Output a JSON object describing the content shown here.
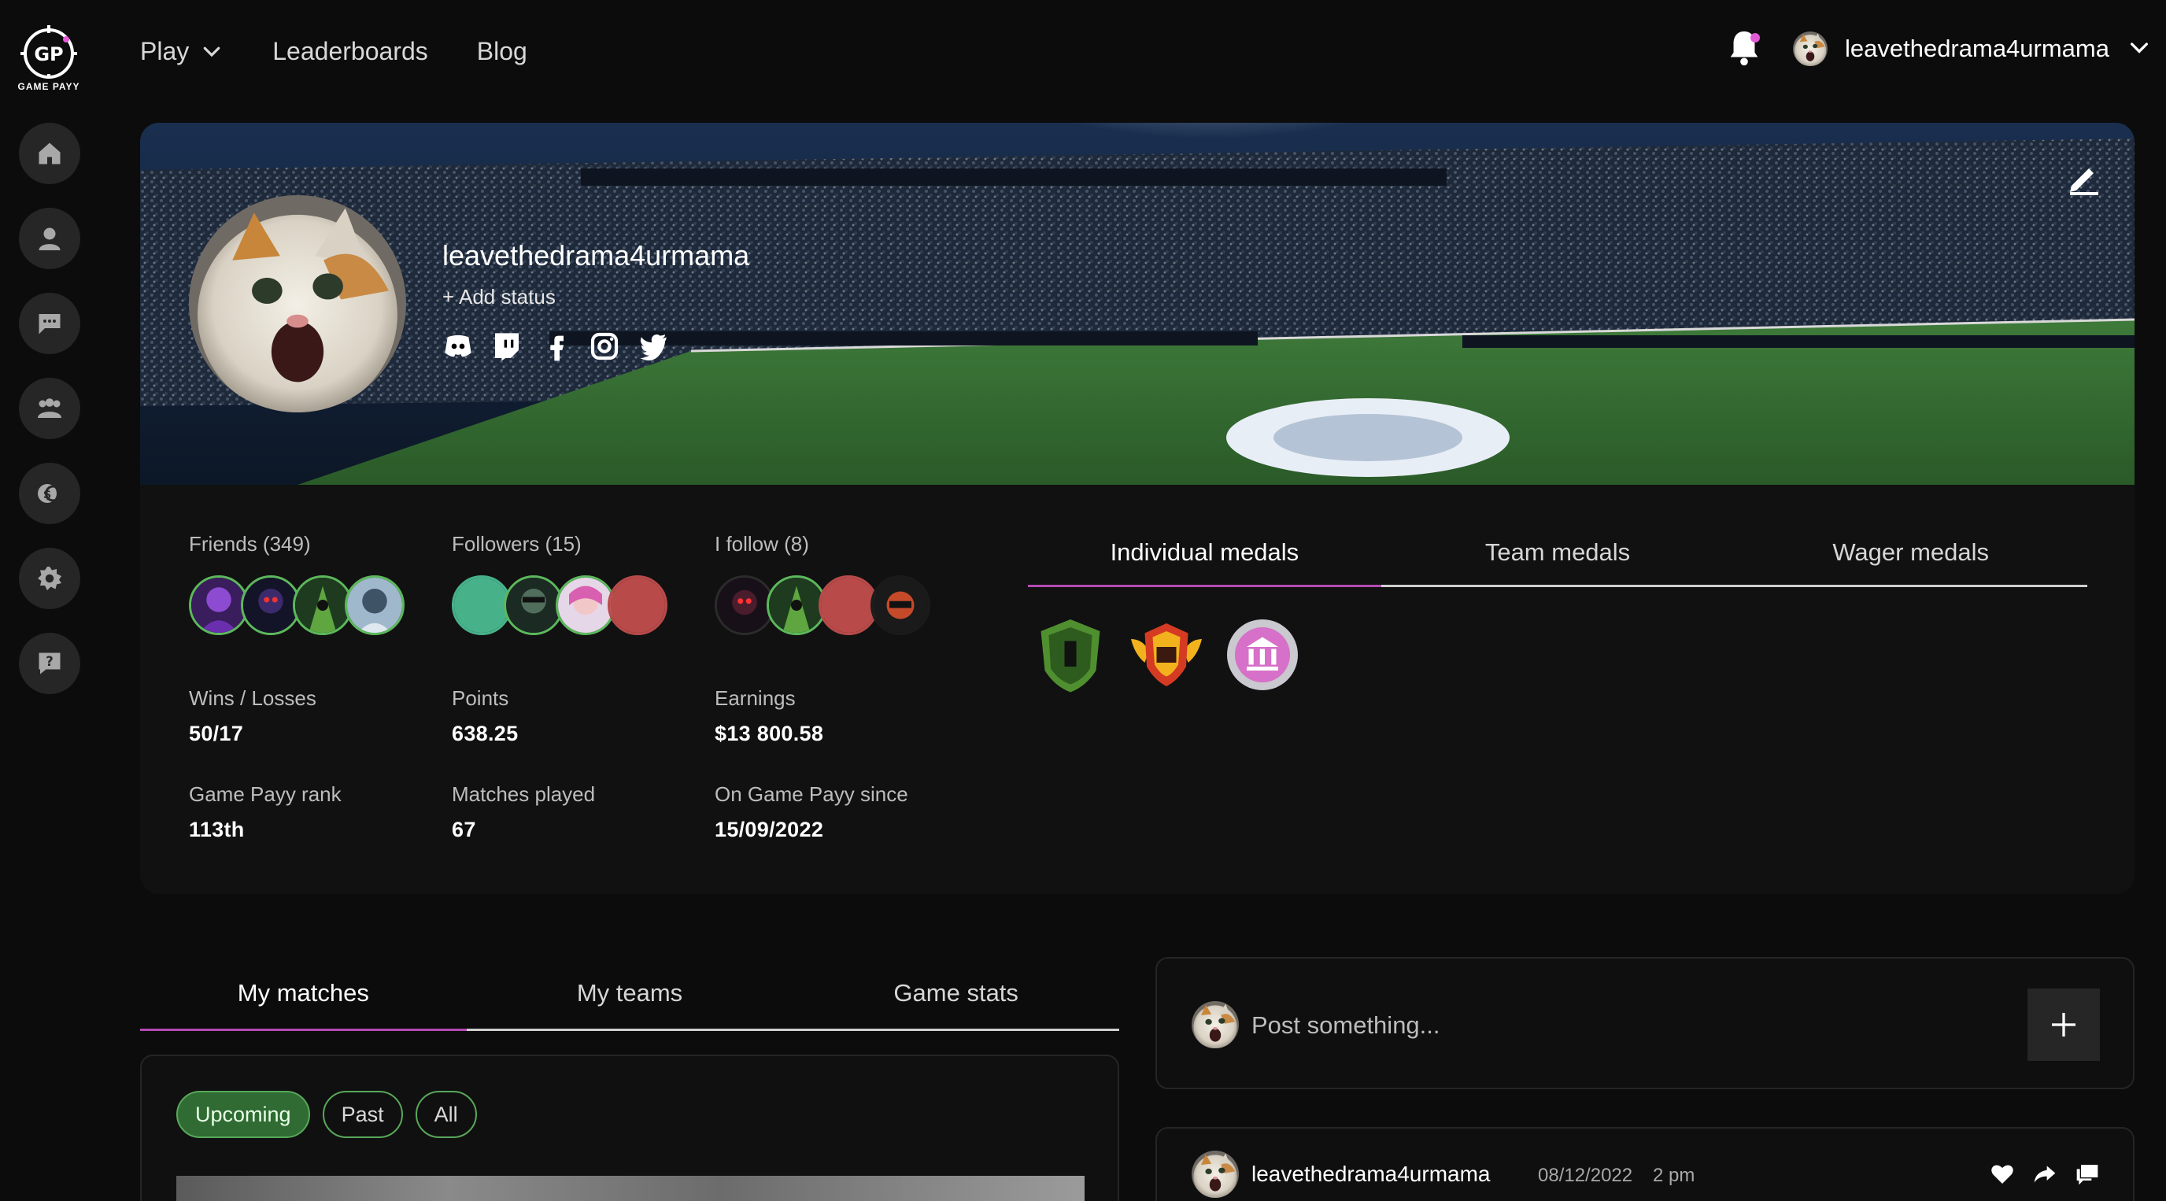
{
  "app": {
    "logo_text": "GAME PAYY",
    "accent": "#b44ab3",
    "green": "#5cb85c"
  },
  "nav": {
    "play": "Play",
    "leaderboards": "Leaderboards",
    "blog": "Blog"
  },
  "user": {
    "name": "leavethedrama4urmama"
  },
  "sidebar": {
    "items": [
      "home-icon",
      "profile-icon",
      "chat-icon",
      "teams-icon",
      "wallet-icon",
      "settings-icon",
      "help-icon"
    ]
  },
  "profile": {
    "name": "leavethedrama4urmama",
    "add_status": "+ Add status",
    "socials": [
      "discord-icon",
      "twitch-icon",
      "facebook-icon",
      "instagram-icon",
      "twitter-icon"
    ]
  },
  "stats": {
    "friends_label": "Friends (349)",
    "followers_label": "Followers (15)",
    "following_label": "I follow (8)",
    "wins_losses_label": "Wins / Losses",
    "wins_losses_value": "50/17",
    "points_label": "Points",
    "points_value": "638.25",
    "earnings_label": "Earnings",
    "earnings_value": "$13 800.58",
    "rank_label": "Game Payy rank",
    "rank_value": "113th",
    "matches_label": "Matches played",
    "matches_value": "67",
    "since_label": "On Game Payy since",
    "since_value": "15/09/2022"
  },
  "medal_tabs": {
    "individual": "Individual medals",
    "team": "Team medals",
    "wager": "Wager medals"
  },
  "match_tabs": {
    "my_matches": "My matches",
    "my_teams": "My teams",
    "game_stats": "Game stats"
  },
  "filters": {
    "upcoming": "Upcoming",
    "past": "Past",
    "all": "All"
  },
  "post": {
    "placeholder": "Post something..."
  },
  "feed": {
    "user": "leavethedrama4urmama",
    "date": "08/12/2022",
    "time": "2 pm"
  }
}
